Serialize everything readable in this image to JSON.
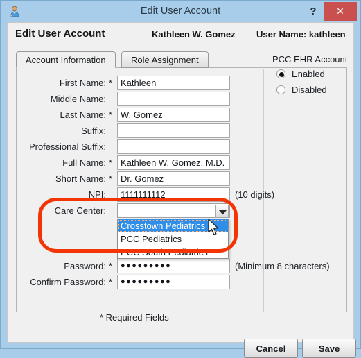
{
  "window": {
    "title": "Edit User Account",
    "title_icon": "user-icon",
    "help_label": "?",
    "close_label": "✕",
    "titlebar_color": "#a8cdeb",
    "close_button_color": "#c9504f"
  },
  "header": {
    "title": "Edit User Account",
    "person_name": "Kathleen  W. Gomez",
    "user_name": "User Name: kathleen"
  },
  "tabs": [
    {
      "label": "Account Information",
      "active": true
    },
    {
      "label": "Role Assignment",
      "active": false
    }
  ],
  "form": {
    "fields": [
      {
        "label": "First Name:",
        "required": "*",
        "value": "Kathleen",
        "hint": ""
      },
      {
        "label": "Middle Name:",
        "required": "",
        "value": "",
        "hint": ""
      },
      {
        "label": "Last Name:",
        "required": "*",
        "value": "W. Gomez",
        "hint": ""
      },
      {
        "label": "Suffix:",
        "required": "",
        "value": "",
        "hint": ""
      },
      {
        "label": "Professional Suffix:",
        "required": "",
        "value": "",
        "hint": ""
      },
      {
        "label": "Full Name:",
        "required": "*",
        "value": "Kathleen W. Gomez, M.D.",
        "hint": ""
      },
      {
        "label": "Short Name:",
        "required": "*",
        "value": "Dr. Gomez",
        "hint": ""
      },
      {
        "label": "NPI:",
        "required": "",
        "value": "1111111112",
        "hint": "(10 digits)"
      }
    ],
    "care_center": {
      "label": "Care Center:",
      "required": "",
      "selected_value": "",
      "expanded": true,
      "options": [
        {
          "label": "Crosstown Pediatrics",
          "highlighted": true
        },
        {
          "label": "PCC Pediatrics",
          "highlighted": false
        },
        {
          "label": "PCC South Pediatrics",
          "highlighted": false
        }
      ],
      "arrow_icon": "chevron-down-icon"
    },
    "password": {
      "label": "Password:",
      "required": "*",
      "value": "●●●●●●●●●",
      "hint": "(Minimum 8 characters)"
    },
    "confirm_password": {
      "label": "Confirm Password:",
      "required": "*",
      "value": "●●●●●●●●●",
      "hint": ""
    },
    "required_note": "* Required Fields"
  },
  "ehr_account": {
    "title": "PCC EHR Account",
    "options": [
      {
        "label": "Enabled",
        "selected": true
      },
      {
        "label": "Disabled",
        "selected": false
      }
    ]
  },
  "footer": {
    "cancel_label": "Cancel",
    "save_label": "Save"
  },
  "annotation": {
    "shape": "rounded-rectangle",
    "color": "#f33505"
  }
}
